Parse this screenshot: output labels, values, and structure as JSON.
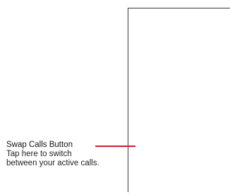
{
  "callout": {
    "title": "Swap Calls Button",
    "description_line1": "Tap here to switch",
    "description_line2": "between your active calls."
  },
  "colors": {
    "leader_line": "#c8202c",
    "frame_line": "#3a3a3a",
    "text": "#111111",
    "background": "#ffffff"
  }
}
